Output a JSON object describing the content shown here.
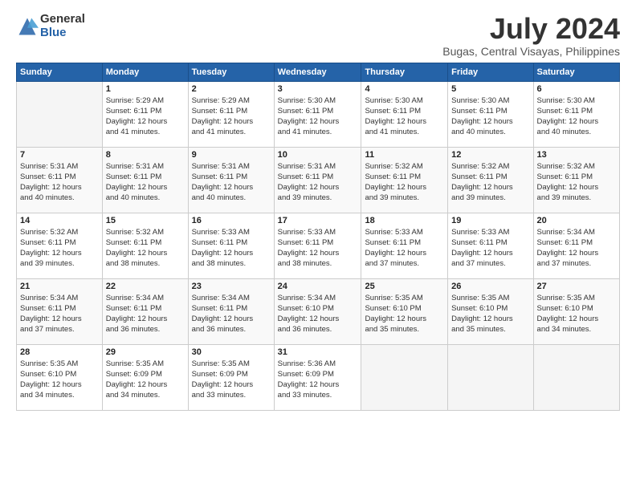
{
  "logo": {
    "general": "General",
    "blue": "Blue"
  },
  "title": "July 2024",
  "location": "Bugas, Central Visayas, Philippines",
  "days_header": [
    "Sunday",
    "Monday",
    "Tuesday",
    "Wednesday",
    "Thursday",
    "Friday",
    "Saturday"
  ],
  "weeks": [
    [
      {
        "num": "",
        "info": ""
      },
      {
        "num": "1",
        "info": "Sunrise: 5:29 AM\nSunset: 6:11 PM\nDaylight: 12 hours\nand 41 minutes."
      },
      {
        "num": "2",
        "info": "Sunrise: 5:29 AM\nSunset: 6:11 PM\nDaylight: 12 hours\nand 41 minutes."
      },
      {
        "num": "3",
        "info": "Sunrise: 5:30 AM\nSunset: 6:11 PM\nDaylight: 12 hours\nand 41 minutes."
      },
      {
        "num": "4",
        "info": "Sunrise: 5:30 AM\nSunset: 6:11 PM\nDaylight: 12 hours\nand 41 minutes."
      },
      {
        "num": "5",
        "info": "Sunrise: 5:30 AM\nSunset: 6:11 PM\nDaylight: 12 hours\nand 40 minutes."
      },
      {
        "num": "6",
        "info": "Sunrise: 5:30 AM\nSunset: 6:11 PM\nDaylight: 12 hours\nand 40 minutes."
      }
    ],
    [
      {
        "num": "7",
        "info": "Sunrise: 5:31 AM\nSunset: 6:11 PM\nDaylight: 12 hours\nand 40 minutes."
      },
      {
        "num": "8",
        "info": "Sunrise: 5:31 AM\nSunset: 6:11 PM\nDaylight: 12 hours\nand 40 minutes."
      },
      {
        "num": "9",
        "info": "Sunrise: 5:31 AM\nSunset: 6:11 PM\nDaylight: 12 hours\nand 40 minutes."
      },
      {
        "num": "10",
        "info": "Sunrise: 5:31 AM\nSunset: 6:11 PM\nDaylight: 12 hours\nand 39 minutes."
      },
      {
        "num": "11",
        "info": "Sunrise: 5:32 AM\nSunset: 6:11 PM\nDaylight: 12 hours\nand 39 minutes."
      },
      {
        "num": "12",
        "info": "Sunrise: 5:32 AM\nSunset: 6:11 PM\nDaylight: 12 hours\nand 39 minutes."
      },
      {
        "num": "13",
        "info": "Sunrise: 5:32 AM\nSunset: 6:11 PM\nDaylight: 12 hours\nand 39 minutes."
      }
    ],
    [
      {
        "num": "14",
        "info": "Sunrise: 5:32 AM\nSunset: 6:11 PM\nDaylight: 12 hours\nand 39 minutes."
      },
      {
        "num": "15",
        "info": "Sunrise: 5:32 AM\nSunset: 6:11 PM\nDaylight: 12 hours\nand 38 minutes."
      },
      {
        "num": "16",
        "info": "Sunrise: 5:33 AM\nSunset: 6:11 PM\nDaylight: 12 hours\nand 38 minutes."
      },
      {
        "num": "17",
        "info": "Sunrise: 5:33 AM\nSunset: 6:11 PM\nDaylight: 12 hours\nand 38 minutes."
      },
      {
        "num": "18",
        "info": "Sunrise: 5:33 AM\nSunset: 6:11 PM\nDaylight: 12 hours\nand 37 minutes."
      },
      {
        "num": "19",
        "info": "Sunrise: 5:33 AM\nSunset: 6:11 PM\nDaylight: 12 hours\nand 37 minutes."
      },
      {
        "num": "20",
        "info": "Sunrise: 5:34 AM\nSunset: 6:11 PM\nDaylight: 12 hours\nand 37 minutes."
      }
    ],
    [
      {
        "num": "21",
        "info": "Sunrise: 5:34 AM\nSunset: 6:11 PM\nDaylight: 12 hours\nand 37 minutes."
      },
      {
        "num": "22",
        "info": "Sunrise: 5:34 AM\nSunset: 6:11 PM\nDaylight: 12 hours\nand 36 minutes."
      },
      {
        "num": "23",
        "info": "Sunrise: 5:34 AM\nSunset: 6:11 PM\nDaylight: 12 hours\nand 36 minutes."
      },
      {
        "num": "24",
        "info": "Sunrise: 5:34 AM\nSunset: 6:10 PM\nDaylight: 12 hours\nand 36 minutes."
      },
      {
        "num": "25",
        "info": "Sunrise: 5:35 AM\nSunset: 6:10 PM\nDaylight: 12 hours\nand 35 minutes."
      },
      {
        "num": "26",
        "info": "Sunrise: 5:35 AM\nSunset: 6:10 PM\nDaylight: 12 hours\nand 35 minutes."
      },
      {
        "num": "27",
        "info": "Sunrise: 5:35 AM\nSunset: 6:10 PM\nDaylight: 12 hours\nand 34 minutes."
      }
    ],
    [
      {
        "num": "28",
        "info": "Sunrise: 5:35 AM\nSunset: 6:10 PM\nDaylight: 12 hours\nand 34 minutes."
      },
      {
        "num": "29",
        "info": "Sunrise: 5:35 AM\nSunset: 6:09 PM\nDaylight: 12 hours\nand 34 minutes."
      },
      {
        "num": "30",
        "info": "Sunrise: 5:35 AM\nSunset: 6:09 PM\nDaylight: 12 hours\nand 33 minutes."
      },
      {
        "num": "31",
        "info": "Sunrise: 5:36 AM\nSunset: 6:09 PM\nDaylight: 12 hours\nand 33 minutes."
      },
      {
        "num": "",
        "info": ""
      },
      {
        "num": "",
        "info": ""
      },
      {
        "num": "",
        "info": ""
      }
    ]
  ]
}
